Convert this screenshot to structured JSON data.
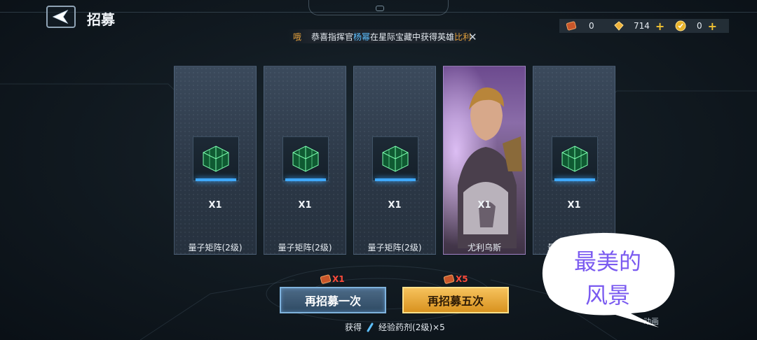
{
  "header": {
    "title": "招募"
  },
  "resources": [
    {
      "icon": "ticket-icon",
      "value": "0"
    },
    {
      "icon": "crystal-icon",
      "value": "714"
    },
    {
      "icon": "coin-icon",
      "value": "0"
    }
  ],
  "announcement": {
    "fragment": "哦",
    "prefix": "恭喜指挥官",
    "player": "杨幂",
    "middle": "在星际宝藏中获得英雄",
    "hero": "比利"
  },
  "cards": [
    {
      "qty": "X1",
      "name": "量子矩阵(2级)"
    },
    {
      "qty": "X1",
      "name": "量子矩阵(2级)"
    },
    {
      "qty": "X1",
      "name": "量子矩阵(2级)"
    },
    {
      "qty": "X1",
      "name": "尤利乌斯"
    },
    {
      "qty": "X1",
      "name": "量"
    }
  ],
  "recruit": {
    "once_cost": "X1",
    "once_label": "再招募一次",
    "five_cost": "X5",
    "five_label": "再招募五次"
  },
  "obtain": {
    "label": "获得",
    "item": "经验药剂(2级)×5"
  },
  "skip": "动画",
  "bubble": {
    "line1": "最美的",
    "line2": "风景"
  },
  "colors": {
    "accent_blue": "#5ec0ff",
    "accent_gold": "#e6a23c",
    "cost_red": "#ff4a3a"
  }
}
